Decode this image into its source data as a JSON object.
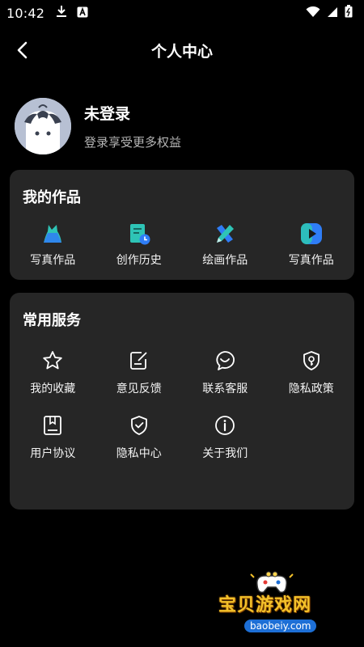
{
  "status_bar": {
    "time": "10:42",
    "icons_left": [
      "download-icon",
      "a-box-icon"
    ],
    "icons_right": [
      "wifi-icon",
      "signal-icon",
      "battery-icon"
    ]
  },
  "app_bar": {
    "title": "个人中心",
    "back_icon": "chevron-left-icon"
  },
  "profile": {
    "name": "未登录",
    "subtitle": "登录享受更多权益"
  },
  "works": {
    "title": "我的作品",
    "items": [
      {
        "label": "写真作品",
        "icon": "dress-icon"
      },
      {
        "label": "创作历史",
        "icon": "history-doc-icon"
      },
      {
        "label": "绘画作品",
        "icon": "brush-icon"
      },
      {
        "label": "写真作品",
        "icon": "play-icon"
      }
    ]
  },
  "services": {
    "title": "常用服务",
    "items": [
      {
        "label": "我的收藏",
        "icon": "star-icon"
      },
      {
        "label": "意见反馈",
        "icon": "edit-note-icon"
      },
      {
        "label": "联系客服",
        "icon": "chat-smile-icon"
      },
      {
        "label": "隐私政策",
        "icon": "shield-key-icon"
      },
      {
        "label": "用户协议",
        "icon": "bookmark-doc-icon"
      },
      {
        "label": "隐私中心",
        "icon": "shield-check-icon"
      },
      {
        "label": "关于我们",
        "icon": "info-icon"
      }
    ]
  },
  "watermark": {
    "title": "宝贝游戏网",
    "url": "baobeiy.com"
  },
  "colors": {
    "background": "#000000",
    "card": "#262626",
    "accent_teal": "#2ec4b6",
    "accent_blue": "#2f7df6",
    "watermark_gold": "#f3c12a"
  }
}
